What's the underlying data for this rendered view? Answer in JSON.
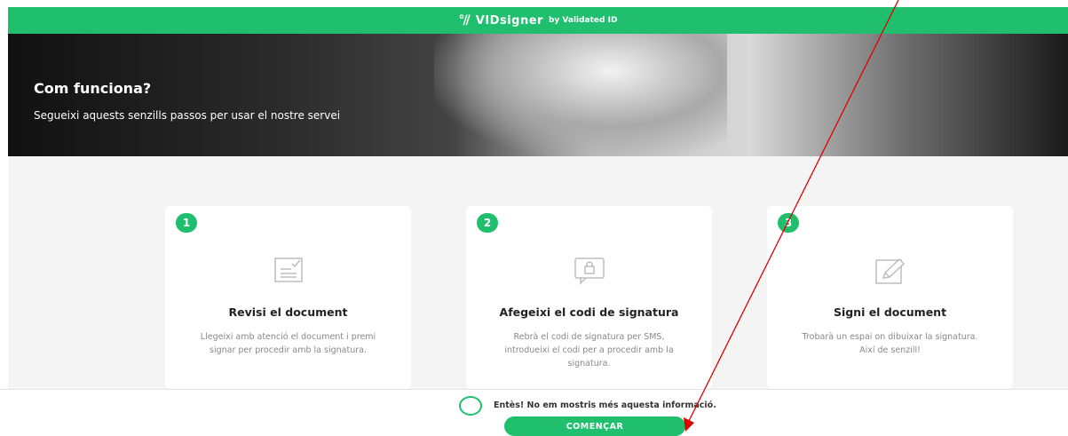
{
  "header": {
    "brand": "VIDsigner",
    "brand_sub": "by Validated ID"
  },
  "hero": {
    "title": "Com funciona?",
    "subtitle": "Segueixi aquests senzills passos per usar el nostre servei"
  },
  "steps": [
    {
      "number": "1",
      "icon": "document-icon",
      "title": "Revisi el document",
      "text": "Llegeixi amb atenció el document i premi signar per procedir amb la signatura."
    },
    {
      "number": "2",
      "icon": "sms-lock-icon",
      "title": "Afegeixi el codi de signatura",
      "text": "Rebrà el codi de signatura per SMS, introdueixi el codi per a procedir amb la signatura."
    },
    {
      "number": "3",
      "icon": "pen-sign-icon",
      "title": "Signi el document",
      "text": "Trobarà un espai on dibuixar la signatura. Així de senzill!"
    }
  ],
  "footer": {
    "checkbox_label": "Entès! No em mostris més aquesta informació.",
    "start_label": "COMENÇAR"
  },
  "colors": {
    "accent": "#1fbf6d",
    "annotation_arrow": "#e00000"
  }
}
